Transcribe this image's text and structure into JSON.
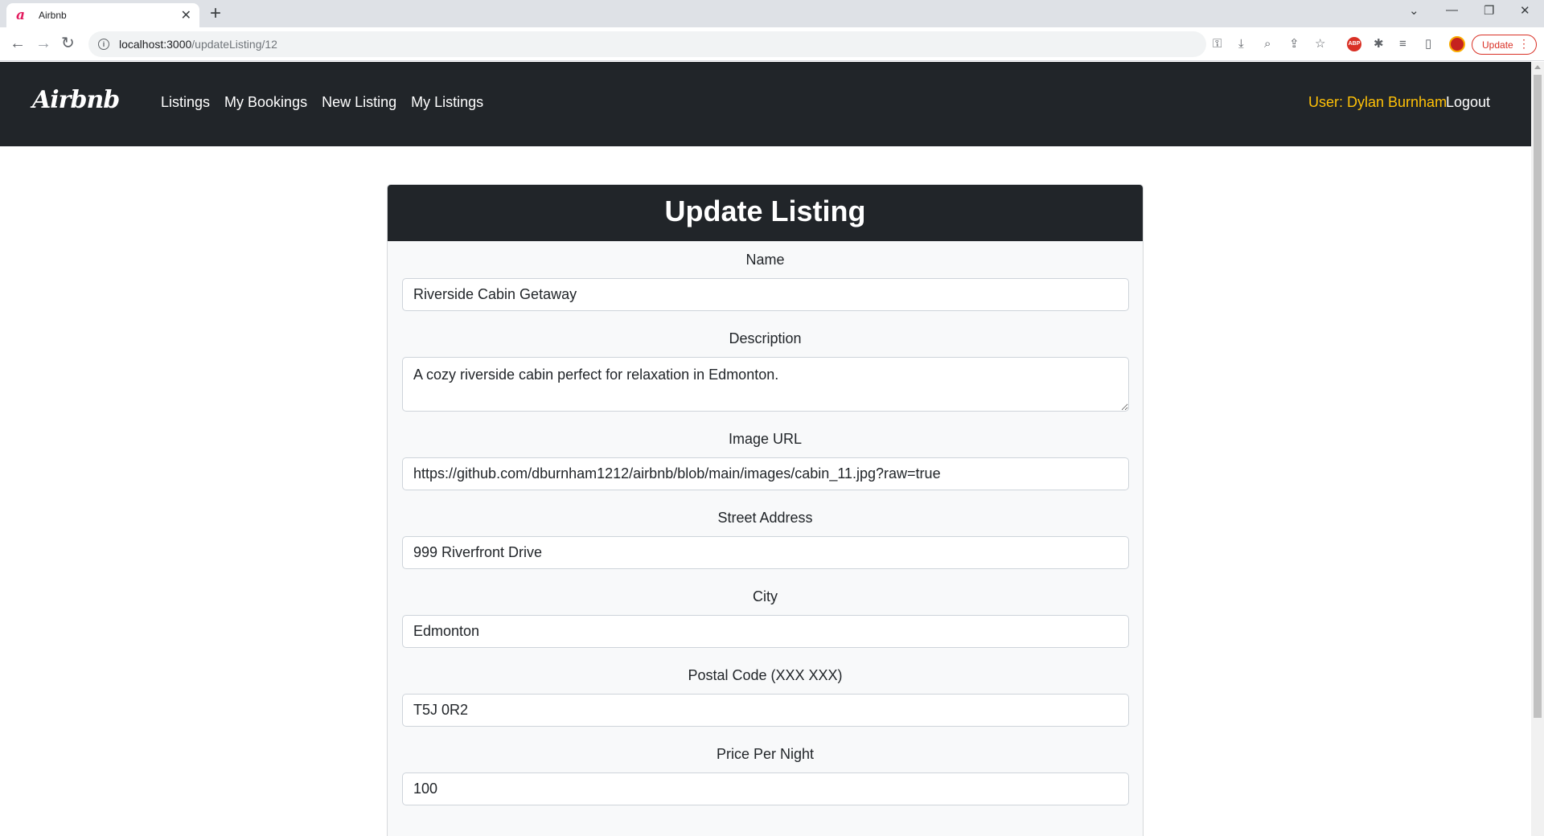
{
  "browser": {
    "tab_title": "Airbnb",
    "tab_favicon": "a",
    "url_host": "localhost:3000",
    "url_path": "/updateListing/12",
    "update_label": "Update"
  },
  "navbar": {
    "brand": "Airbnb",
    "links": [
      "Listings",
      "My Bookings",
      "New Listing",
      "My Listings"
    ],
    "user_label": "User: Dylan Burnham",
    "logout_label": "Logout"
  },
  "form": {
    "title": "Update Listing",
    "fields": [
      {
        "label": "Name",
        "value": "Riverside Cabin Getaway"
      },
      {
        "label": "Description",
        "value": "A cozy riverside cabin perfect for relaxation in Edmonton."
      },
      {
        "label": "Image URL",
        "value": "https://github.com/dburnham1212/airbnb/blob/main/images/cabin_11.jpg?raw=true"
      },
      {
        "label": "Street Address",
        "value": "999 Riverfront Drive"
      },
      {
        "label": "City",
        "value": "Edmonton"
      },
      {
        "label": "Postal Code (XXX XXX)",
        "value": "T5J 0R2"
      },
      {
        "label": "Price Per Night",
        "value": "100"
      }
    ]
  },
  "colors": {
    "navbar_bg": "#212529",
    "user_accent": "#ffc107",
    "card_bg": "#f8f9fa"
  },
  "icons": [
    "back-icon",
    "forward-icon",
    "reload-icon",
    "info-icon",
    "key-icon",
    "install-icon",
    "zoom-icon",
    "share-icon",
    "star-icon",
    "adblock-icon",
    "extensions-icon",
    "reading-list-icon",
    "side-panel-icon",
    "profile-avatar-icon",
    "kebab-menu-icon"
  ]
}
